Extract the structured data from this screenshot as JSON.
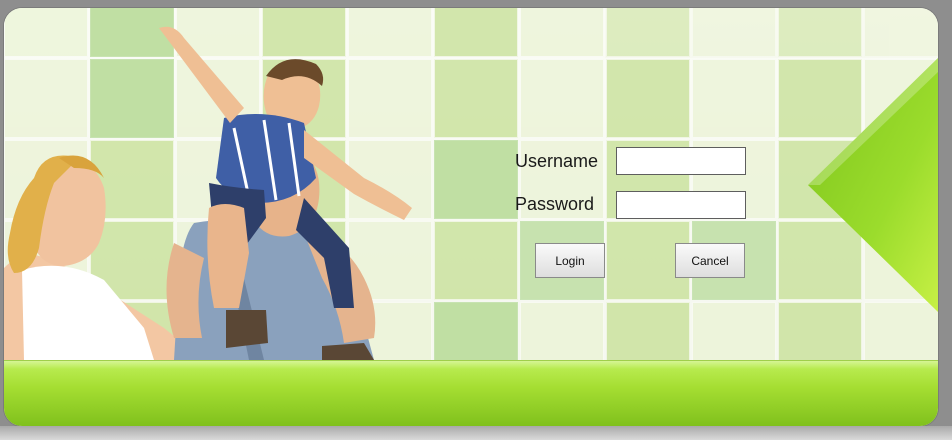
{
  "login_form": {
    "username_label": "Username",
    "password_label": "Password",
    "username_value": "",
    "password_value": "",
    "login_button": "Login",
    "cancel_button": "Cancel"
  },
  "theme": {
    "accent_green": "#9fd92b",
    "dark_green": "#6fb414",
    "tile_light": "#eef5dc",
    "tile_dark": "#b8dba0"
  },
  "hero_image": {
    "icon": "family-photo"
  }
}
